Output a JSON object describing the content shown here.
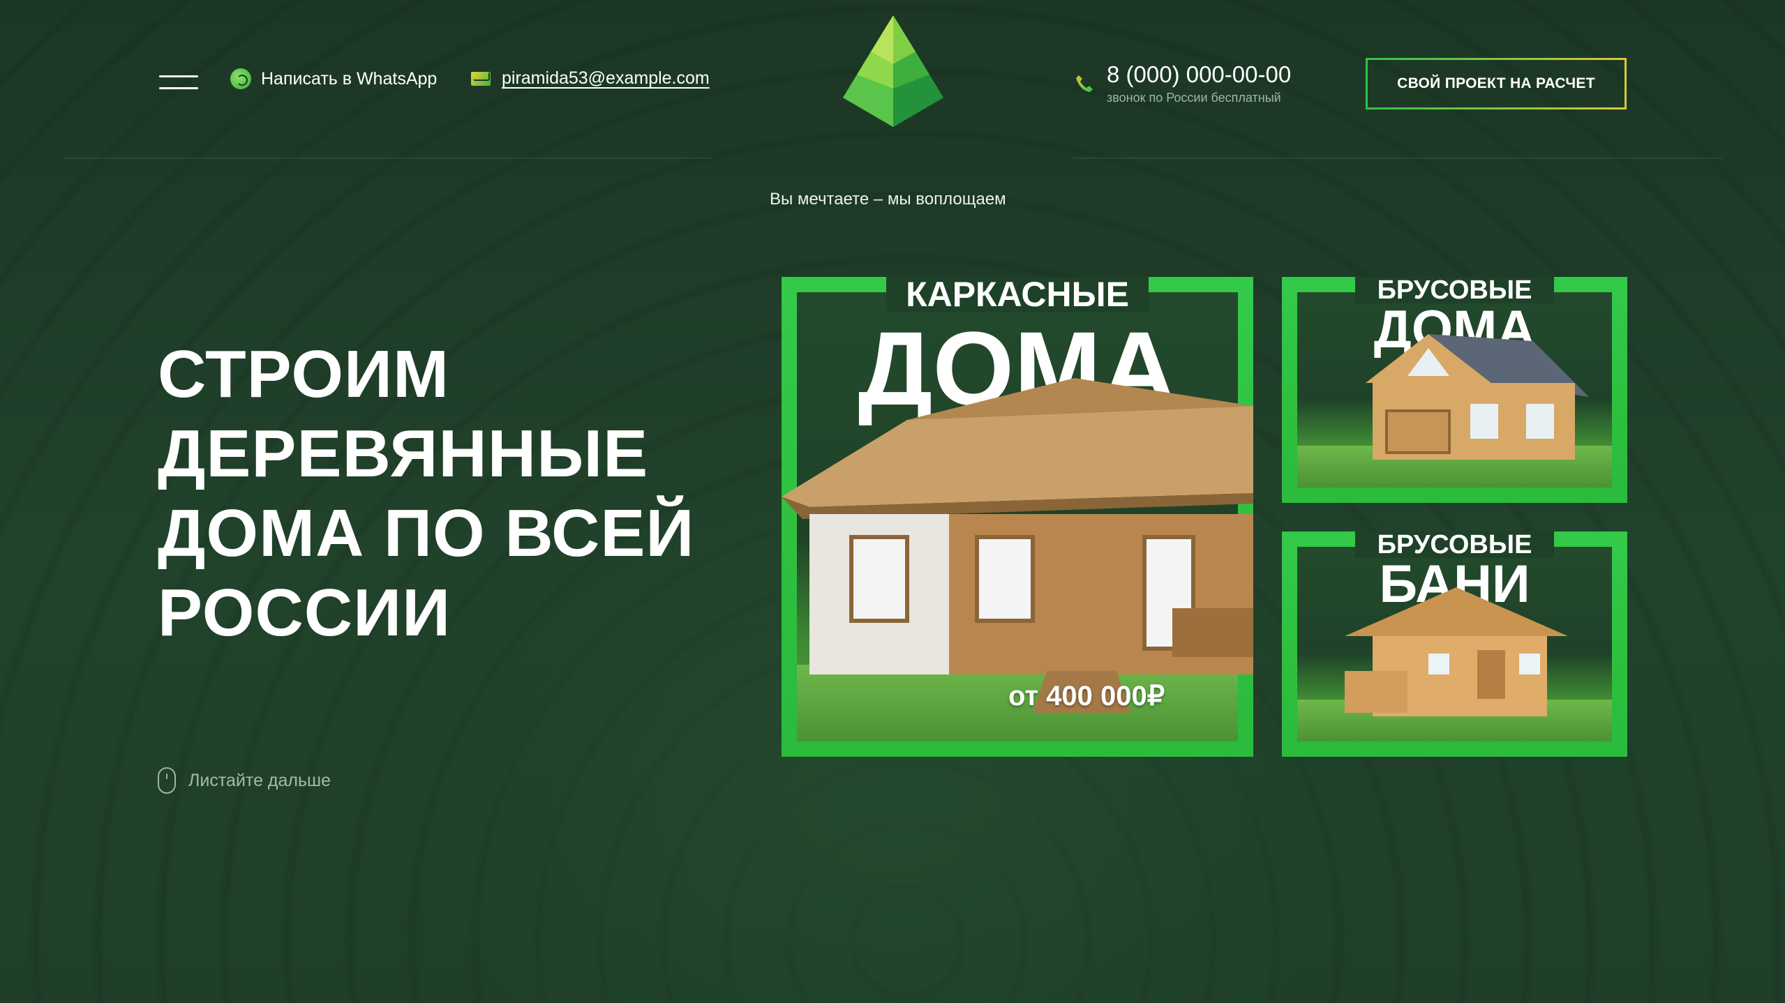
{
  "header": {
    "whatsapp_label": "Написать в WhatsApp",
    "email": "piramida53@example.com",
    "phone_number": "8 (000) 000-00-00",
    "phone_note": "звонок по России бесплатный",
    "cta_label": "СВОЙ ПРОЕКТ НА РАСЧЕТ"
  },
  "tagline": "Вы мечтаете – мы воплощаем",
  "hero": {
    "title": "СТРОИМ ДЕРЕВЯННЫЕ ДОМА ПО ВСЕЙ РОССИИ",
    "scroll_label": "Листайте дальше"
  },
  "cards": {
    "main": {
      "caption_top": "КАРКАСНЫЕ",
      "caption_big": "ДОМА",
      "price": "от 400 000₽"
    },
    "small1": {
      "caption_top": "БРУСОВЫЕ",
      "caption_big": "ДОМА"
    },
    "small2": {
      "caption_top": "БРУСОВЫЕ",
      "caption_big": "БАНИ"
    }
  },
  "colors": {
    "background": "#1d3a26",
    "accent_green": "#2fc24a",
    "accent_yellow": "#d9c93a",
    "muted_text": "#9fb5a2"
  },
  "icons": [
    "menu-icon",
    "whatsapp-icon",
    "mail-icon",
    "logo-pyramid",
    "phone-icon",
    "mouse-icon"
  ]
}
